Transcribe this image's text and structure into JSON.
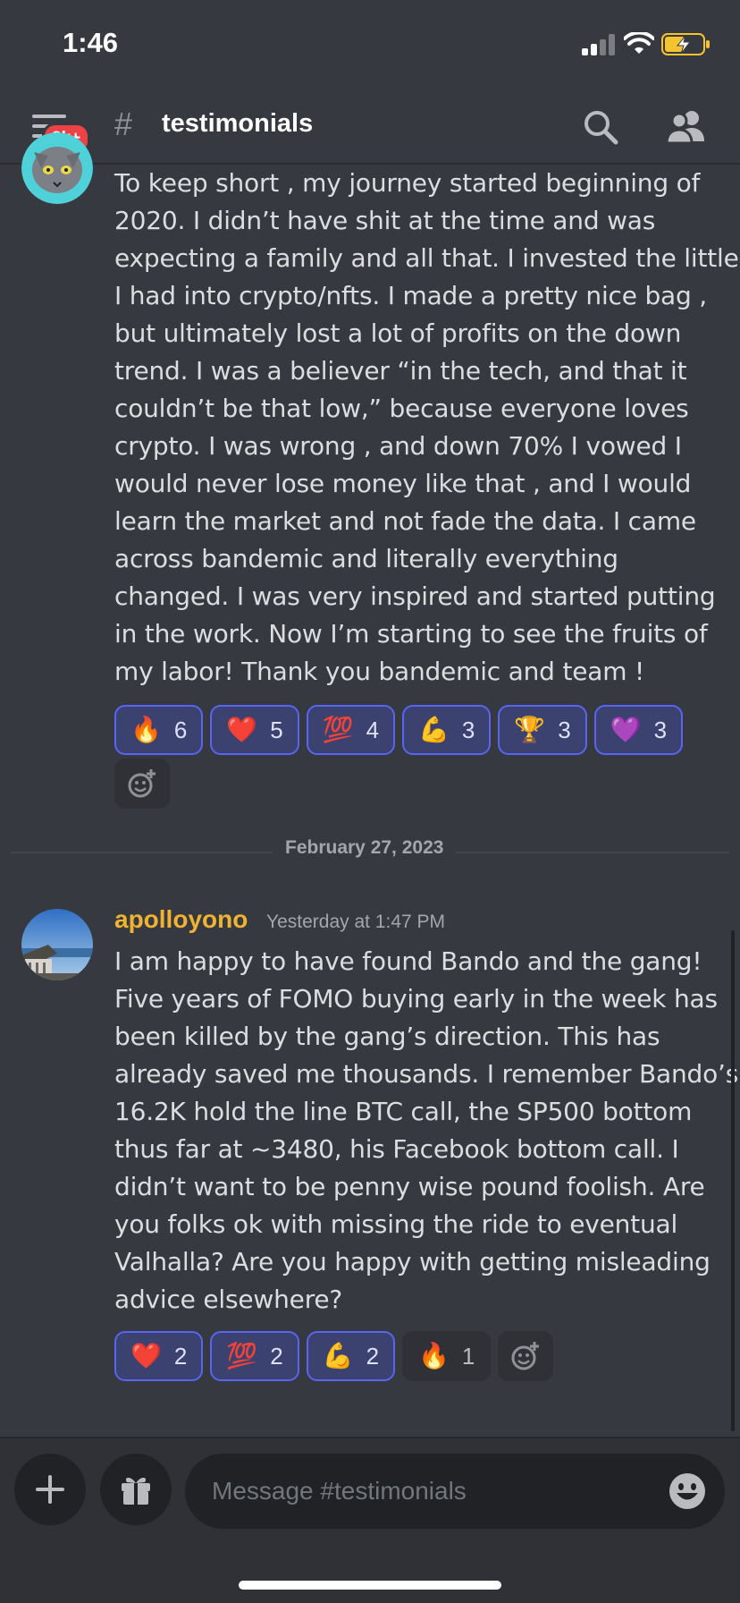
{
  "status_bar": {
    "time": "1:46"
  },
  "header": {
    "unread_badge": "2k+",
    "hash": "#",
    "channel_name": "testimonials"
  },
  "message1": {
    "lines": [
      "To keep short , my journey started beginning of",
      "2020. I didn’t have shit at the time and was",
      "expecting a family and all that. I invested the little",
      "I had into crypto/nfts. I made a pretty nice bag ,",
      "but ultimately lost a lot of profits on the down",
      "trend. I was a believer “in the tech, and that it",
      "couldn’t be that low,” because everyone loves",
      "crypto. I was wrong , and down 70% I vowed I",
      "would never lose money like that , and I would",
      "learn the market and not fade the data. I came",
      "across bandemic and literally everything",
      "changed. I was very inspired and started putting",
      "in the work. Now I’m starting to see the fruits of",
      "my labor! Thank you bandemic and team !"
    ],
    "reactions": [
      {
        "emoji": "🔥",
        "count": "6",
        "icon": "fire-emoji"
      },
      {
        "emoji": "❤️",
        "count": "5",
        "icon": "red-heart-emoji"
      },
      {
        "emoji": "💯",
        "count": "4",
        "icon": "hundred-points-emoji"
      },
      {
        "emoji": "💪",
        "count": "3",
        "icon": "flexed-biceps-emoji"
      },
      {
        "emoji": "🏆",
        "count": "3",
        "icon": "trophy-emoji"
      },
      {
        "emoji": "💜",
        "count": "3",
        "icon": "purple-heart-emoji"
      }
    ]
  },
  "date_divider": "February 27, 2023",
  "message2": {
    "username": "apolloyono",
    "timestamp": "Yesterday at 1:47 PM",
    "lines": [
      "I am happy to have found Bando and the gang!",
      "Five years of FOMO buying early in the week has",
      "been killed by the gang’s direction. This has",
      "already saved me thousands. I remember Bando’s",
      "16.2K hold the line BTC call, the SP500 bottom",
      "thus far at ~3480, his Facebook bottom call. I",
      "didn’t want to be penny wise pound foolish. Are",
      "you folks ok with missing the ride to eventual",
      "Valhalla? Are you happy with getting misleading",
      "advice elsewhere?"
    ],
    "reactions": [
      {
        "emoji": "❤️",
        "count": "2",
        "icon": "red-heart-emoji"
      },
      {
        "emoji": "💯",
        "count": "2",
        "icon": "hundred-points-emoji"
      },
      {
        "emoji": "💪",
        "count": "2",
        "icon": "mechanical-arm-emoji"
      },
      {
        "emoji": "🔥",
        "count": "1",
        "icon": "fire-emoji"
      }
    ]
  },
  "composer": {
    "placeholder": "Message #testimonials"
  },
  "colors": {
    "background": "#36393f",
    "username": "#f0b232",
    "reaction_active_border": "#5865f2",
    "badge": "#ed4245"
  }
}
